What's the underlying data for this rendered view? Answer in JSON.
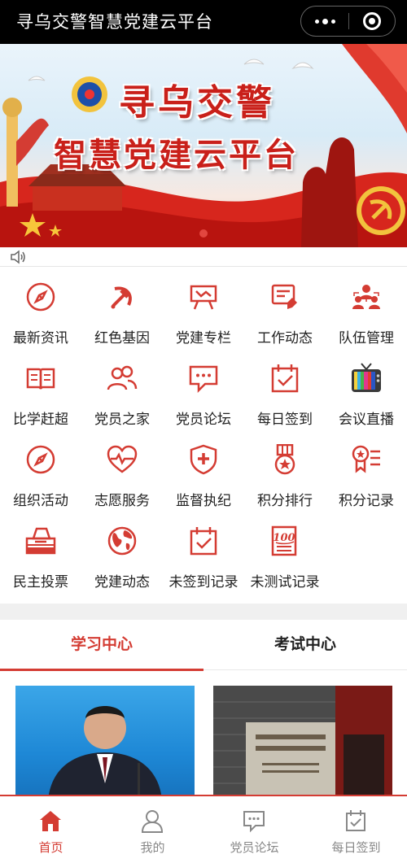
{
  "titlebar": {
    "title": "寻乌交警智慧党建云平台"
  },
  "banner": {
    "line1": "寻乌交警",
    "line2": "智慧党建云平台"
  },
  "grid": {
    "items": [
      {
        "label": "最新资讯",
        "icon": "compass-icon"
      },
      {
        "label": "红色基因",
        "icon": "hammer-sickle-icon"
      },
      {
        "label": "党建专栏",
        "icon": "easel-icon"
      },
      {
        "label": "工作动态",
        "icon": "edit-document-icon"
      },
      {
        "label": "队伍管理",
        "icon": "team-icon"
      },
      {
        "label": "比学赶超",
        "icon": "book-icon"
      },
      {
        "label": "党员之家",
        "icon": "people-icon"
      },
      {
        "label": "党员论坛",
        "icon": "chat-bubble-icon"
      },
      {
        "label": "每日签到",
        "icon": "calendar-check-icon"
      },
      {
        "label": "会议直播",
        "icon": "tv-icon"
      },
      {
        "label": "组织活动",
        "icon": "compass-icon"
      },
      {
        "label": "志愿服务",
        "icon": "heart-pulse-icon"
      },
      {
        "label": "监督执纪",
        "icon": "shield-plus-icon"
      },
      {
        "label": "积分排行",
        "icon": "medal-icon"
      },
      {
        "label": "积分记录",
        "icon": "badge-list-icon"
      },
      {
        "label": "民主投票",
        "icon": "ballot-box-icon"
      },
      {
        "label": "党建动态",
        "icon": "globe-icon"
      },
      {
        "label": "未签到记录",
        "icon": "calendar-check-icon"
      },
      {
        "label": "未测试记录",
        "icon": "score-100-icon"
      }
    ]
  },
  "tabs": [
    {
      "label": "学习中心",
      "active": true
    },
    {
      "label": "考试中心",
      "active": false
    }
  ],
  "nav": [
    {
      "label": "首页",
      "icon": "home-icon",
      "active": true
    },
    {
      "label": "我的",
      "icon": "user-icon",
      "active": false
    },
    {
      "label": "党员论坛",
      "icon": "chat-bubble-icon",
      "active": false
    },
    {
      "label": "每日签到",
      "icon": "calendar-check-icon",
      "active": false
    }
  ],
  "colors": {
    "accent": "#d43c33",
    "titlebar": "#000000"
  }
}
